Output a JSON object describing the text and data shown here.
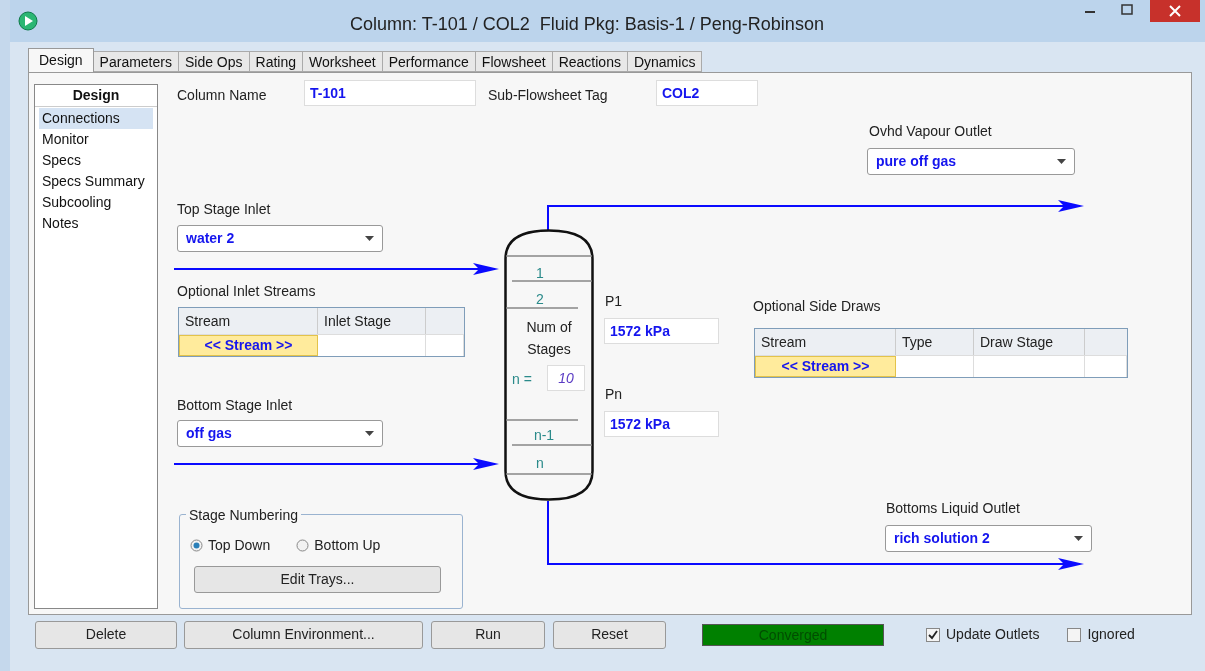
{
  "window": {
    "title": "Column: T-101 / COL2  Fluid Pkg: Basis-1 / Peng-Robinson"
  },
  "tabs": [
    {
      "label": "Design",
      "selected": true
    },
    {
      "label": "Parameters",
      "selected": false
    },
    {
      "label": "Side Ops",
      "selected": false
    },
    {
      "label": "Rating",
      "selected": false
    },
    {
      "label": "Worksheet",
      "selected": false
    },
    {
      "label": "Performance",
      "selected": false
    },
    {
      "label": "Flowsheet",
      "selected": false
    },
    {
      "label": "Reactions",
      "selected": false
    },
    {
      "label": "Dynamics",
      "selected": false
    }
  ],
  "sidebar": {
    "title": "Design",
    "items": [
      {
        "label": "Connections",
        "selected": true
      },
      {
        "label": "Monitor",
        "selected": false
      },
      {
        "label": "Specs",
        "selected": false
      },
      {
        "label": "Specs Summary",
        "selected": false
      },
      {
        "label": "Subcooling",
        "selected": false
      },
      {
        "label": "Notes",
        "selected": false
      }
    ]
  },
  "column_name": {
    "label": "Column Name",
    "value": "T-101"
  },
  "sub_flowsheet_tag": {
    "label": "Sub-Flowsheet Tag",
    "value": "COL2"
  },
  "ovhd_vapour_outlet": {
    "label": "Ovhd Vapour Outlet",
    "value": "pure off gas"
  },
  "top_stage_inlet": {
    "label": "Top Stage Inlet",
    "value": "water 2"
  },
  "optional_inlet_streams": {
    "label": "Optional Inlet Streams",
    "columns": [
      "Stream",
      "Inlet Stage"
    ],
    "rows": [
      [
        "<< Stream >>",
        ""
      ]
    ]
  },
  "bottom_stage_inlet": {
    "label": "Bottom Stage Inlet",
    "value": "off gas"
  },
  "column_diagram": {
    "top_stages": [
      "1",
      "2"
    ],
    "bottom_stages": [
      "n-1",
      "n"
    ],
    "num_label": "Num of Stages",
    "n_label": "n =",
    "n_value": "10"
  },
  "p1": {
    "label": "P1",
    "value": "1572 kPa"
  },
  "pn": {
    "label": "Pn",
    "value": "1572 kPa"
  },
  "optional_side_draws": {
    "label": "Optional Side Draws",
    "columns": [
      "Stream",
      "Type",
      "Draw Stage"
    ],
    "rows": [
      [
        "<< Stream >>",
        "",
        ""
      ]
    ]
  },
  "bottoms_liquid_outlet": {
    "label": "Bottoms Liquid Outlet",
    "value": "rich solution 2"
  },
  "stage_numbering": {
    "title": "Stage Numbering",
    "options": [
      {
        "label": "Top Down",
        "selected": true
      },
      {
        "label": "Bottom Up",
        "selected": false
      }
    ],
    "button": "Edit Trays..."
  },
  "buttons": [
    "Delete",
    "Column Environment...",
    "Run",
    "Reset"
  ],
  "status": {
    "text": "Converged"
  },
  "checkboxes": [
    {
      "label": "Update Outlets",
      "checked": true
    },
    {
      "label": "Ignored",
      "checked": false
    }
  ]
}
